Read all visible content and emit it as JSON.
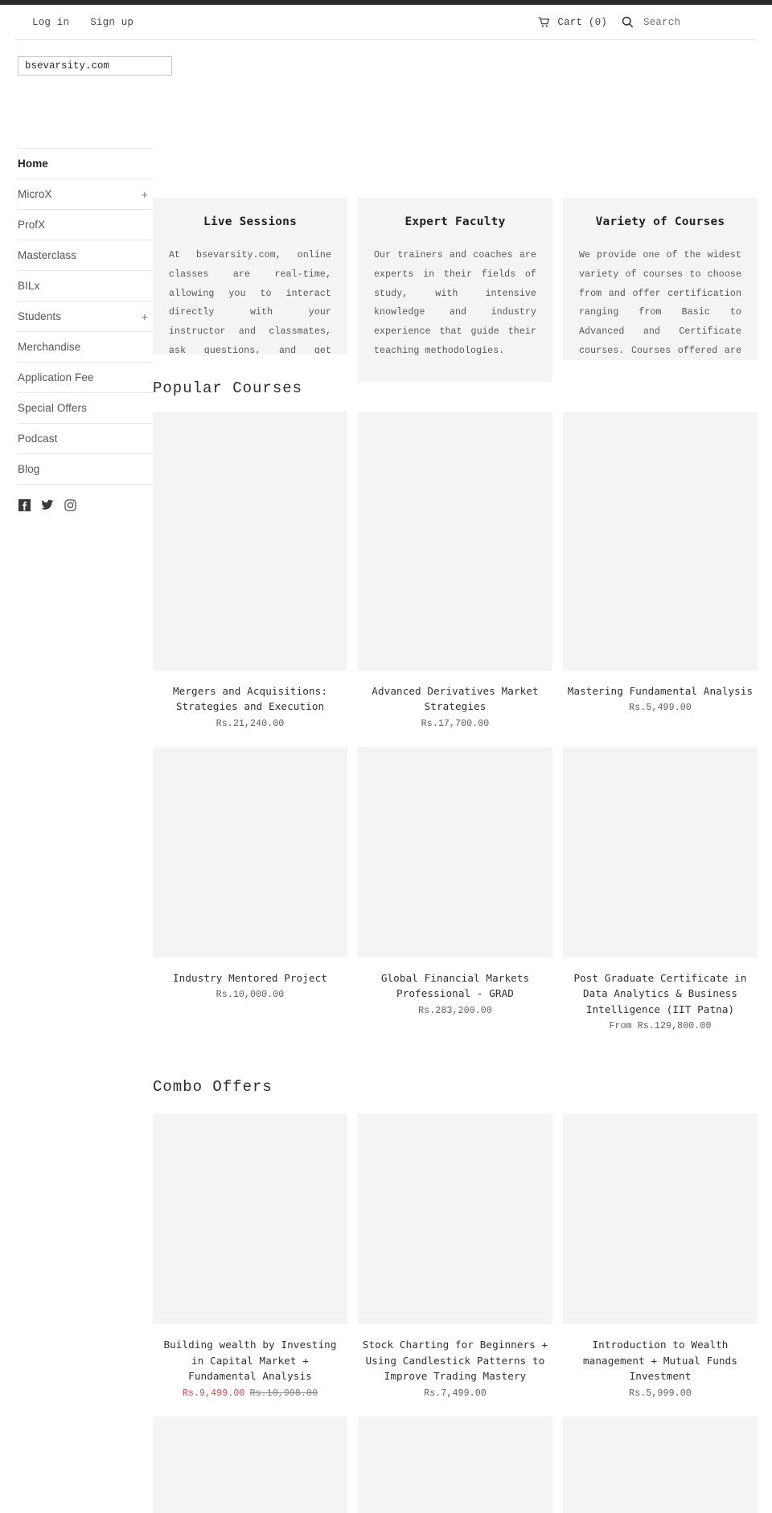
{
  "header": {
    "login_label": "Log in",
    "signup_label": "Sign up",
    "cart_label": "Cart (0)",
    "cart_icon": "shopping-cart-icon",
    "search_icon": "search-icon",
    "search_placeholder": "Search",
    "search_value": ""
  },
  "logo_field": {
    "value": "bsevarsity.com"
  },
  "sidebar": {
    "items": [
      {
        "label": "Home",
        "active": true,
        "expandable": false,
        "expand_glyph": ""
      },
      {
        "label": "MicroX",
        "active": false,
        "expandable": true,
        "expand_glyph": "+"
      },
      {
        "label": "ProfX",
        "active": false,
        "expandable": false,
        "expand_glyph": ""
      },
      {
        "label": "Masterclass",
        "active": false,
        "expandable": false,
        "expand_glyph": ""
      },
      {
        "label": "BILx",
        "active": false,
        "expandable": false,
        "expand_glyph": ""
      },
      {
        "label": "Students",
        "active": false,
        "expandable": true,
        "expand_glyph": "+"
      },
      {
        "label": "Merchandise",
        "active": false,
        "expandable": false,
        "expand_glyph": ""
      },
      {
        "label": "Application Fee",
        "active": false,
        "expandable": false,
        "expand_glyph": ""
      },
      {
        "label": "Special Offers",
        "active": false,
        "expandable": false,
        "expand_glyph": ""
      },
      {
        "label": "Podcast",
        "active": false,
        "expandable": false,
        "expand_glyph": ""
      },
      {
        "label": "Blog",
        "active": false,
        "expandable": false,
        "expand_glyph": ""
      }
    ],
    "social": [
      {
        "name": "facebook-icon",
        "label": "Facebook"
      },
      {
        "name": "twitter-icon",
        "label": "Twitter"
      },
      {
        "name": "instagram-icon",
        "label": "Instagram"
      }
    ]
  },
  "features": [
    {
      "title": "Live Sessions",
      "text": "At bsevarsity.com, online classes are real-time, allowing you to interact directly with your instructor and classmates, ask questions, and get immediate feedback. bsevarsity.com delivers a holistic classroom experience in the comfort of your homes."
    },
    {
      "title": "Expert Faculty",
      "text": "Our trainers and coaches are experts in their fields of study, with intensive knowledge and industry experience that guide their teaching methodologies."
    },
    {
      "title": "Variety of Courses",
      "text": "We provide one of the widest variety of courses to choose from and offer certification ranging from Basic to Advanced and Certificate courses. Courses offered are from Investing, Trading, Data Science, Financial Markets, Technology, Journalism, Law and Leadership."
    }
  ],
  "popular_courses": {
    "heading": "Popular Courses",
    "items": [
      {
        "title": "Mergers and Acquisitions: Strategies and Execution",
        "price": "Rs.21,240.00",
        "sale_price": "",
        "was_price": ""
      },
      {
        "title": "Advanced Derivatives Market Strategies",
        "price": "Rs.17,700.00",
        "sale_price": "",
        "was_price": ""
      },
      {
        "title": "Mastering Fundamental Analysis",
        "price": "Rs.5,499.00",
        "sale_price": "",
        "was_price": ""
      },
      {
        "title": "Industry Mentored Project",
        "price": "Rs.10,000.00",
        "sale_price": "",
        "was_price": ""
      },
      {
        "title": "Global Financial Markets Professional - GRAD",
        "price": "Rs.283,200.00",
        "sale_price": "",
        "was_price": ""
      },
      {
        "title": "Post Graduate Certificate in Data Analytics & Business Intelligence (IIT Patna)",
        "price": "From Rs.129,800.00",
        "sale_price": "",
        "was_price": ""
      }
    ]
  },
  "combo_offers": {
    "heading": "Combo Offers",
    "items": [
      {
        "title": "Building wealth by Investing in Capital Market + Fundamental Analysis",
        "price": "",
        "sale_price": "Rs.9,499.00",
        "was_price": "Rs.10,998.00"
      },
      {
        "title": "Stock Charting for Beginners + Using Candlestick Patterns to Improve Trading Mastery",
        "price": "Rs.7,499.00",
        "sale_price": "",
        "was_price": ""
      },
      {
        "title": "Introduction to Wealth management + Mutual Funds Investment",
        "price": "Rs.5,999.00",
        "sale_price": "",
        "was_price": ""
      }
    ]
  },
  "colors": {
    "accent_sale": "#d24a43",
    "thumb_bg": "#f4f4f4",
    "text": "#333333"
  }
}
